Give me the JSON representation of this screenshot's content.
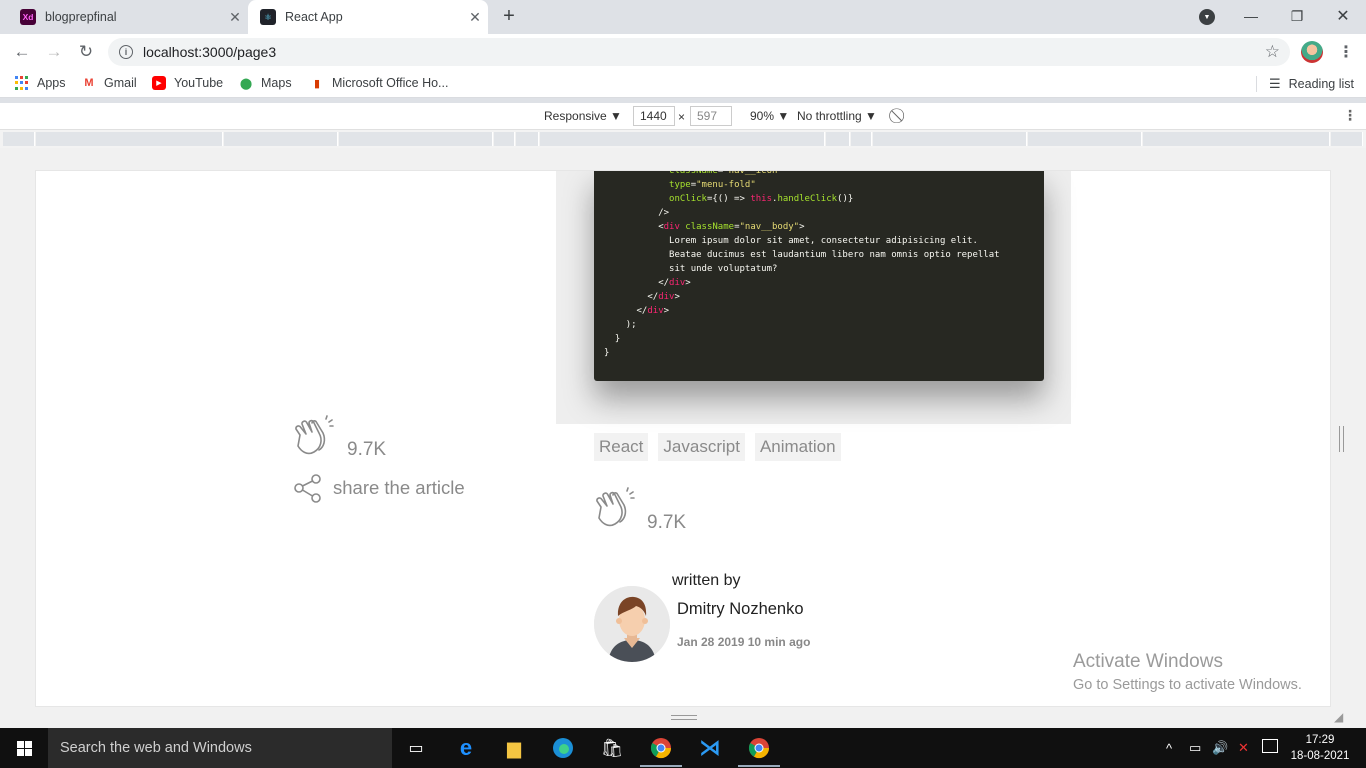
{
  "browser": {
    "tabs": [
      {
        "title": "blogprepfinal",
        "favicon": "adobe-xd-icon",
        "active": false
      },
      {
        "title": "React App",
        "favicon": "react-icon",
        "active": true
      }
    ],
    "new_tab_symbol": "+",
    "url": "localhost:3000/page3",
    "bookmarks": [
      {
        "label": "Apps",
        "icon": "apps-grid-icon"
      },
      {
        "label": "Gmail",
        "icon": "gmail-icon"
      },
      {
        "label": "YouTube",
        "icon": "youtube-icon"
      },
      {
        "label": "Maps",
        "icon": "maps-icon"
      },
      {
        "label": "Microsoft Office Ho...",
        "icon": "office-icon"
      }
    ],
    "reading_list": "Reading list"
  },
  "devtools": {
    "device": "Responsive",
    "width": "1440",
    "height": "597",
    "zoom": "90%",
    "throttling": "No throttling",
    "times": "×"
  },
  "article": {
    "code_lines": [
      {
        "indent": "            ",
        "parts": [
          {
            "t": "className",
            "c": "c-attr"
          },
          {
            "t": "=",
            "c": ""
          },
          {
            "t": "\"nav__icon\"",
            "c": "c-str"
          }
        ]
      },
      {
        "indent": "            ",
        "parts": [
          {
            "t": "type",
            "c": "c-attr"
          },
          {
            "t": "=",
            "c": ""
          },
          {
            "t": "\"menu-fold\"",
            "c": "c-str"
          }
        ]
      },
      {
        "indent": "            ",
        "parts": [
          {
            "t": "onClick",
            "c": "c-attr"
          },
          {
            "t": "={() => ",
            "c": ""
          },
          {
            "t": "this",
            "c": "c-kw"
          },
          {
            "t": ".",
            "c": ""
          },
          {
            "t": "handleClick",
            "c": "c-fn"
          },
          {
            "t": "()}",
            "c": ""
          }
        ]
      },
      {
        "indent": "          ",
        "parts": [
          {
            "t": "/>",
            "c": ""
          }
        ]
      },
      {
        "indent": "          ",
        "parts": [
          {
            "t": "<",
            "c": ""
          },
          {
            "t": "div",
            "c": "c-tag"
          },
          {
            "t": " ",
            "c": ""
          },
          {
            "t": "className",
            "c": "c-attr"
          },
          {
            "t": "=",
            "c": ""
          },
          {
            "t": "\"nav__body\"",
            "c": "c-str"
          },
          {
            "t": ">",
            "c": ""
          }
        ]
      },
      {
        "indent": "            ",
        "parts": [
          {
            "t": "Lorem ipsum dolor sit amet, consectetur adipisicing elit.",
            "c": ""
          }
        ]
      },
      {
        "indent": "            ",
        "parts": [
          {
            "t": "Beatae ducimus est laudantium libero nam omnis optio repellat",
            "c": ""
          }
        ]
      },
      {
        "indent": "            ",
        "parts": [
          {
            "t": "sit unde voluptatum?",
            "c": ""
          }
        ]
      },
      {
        "indent": "          ",
        "parts": [
          {
            "t": "</",
            "c": ""
          },
          {
            "t": "div",
            "c": "c-tag"
          },
          {
            "t": ">",
            "c": ""
          }
        ]
      },
      {
        "indent": "        ",
        "parts": [
          {
            "t": "</",
            "c": ""
          },
          {
            "t": "div",
            "c": "c-tag"
          },
          {
            "t": ">",
            "c": ""
          }
        ]
      },
      {
        "indent": "      ",
        "parts": [
          {
            "t": "</",
            "c": ""
          },
          {
            "t": "div",
            "c": "c-tag"
          },
          {
            "t": ">",
            "c": ""
          }
        ]
      },
      {
        "indent": "    ",
        "parts": [
          {
            "t": ");",
            "c": ""
          }
        ]
      },
      {
        "indent": "  ",
        "parts": [
          {
            "t": "}",
            "c": ""
          }
        ]
      },
      {
        "indent": "",
        "parts": [
          {
            "t": "}",
            "c": ""
          }
        ]
      }
    ],
    "side_clap_count": "9.7K",
    "share_label": "share the article",
    "tags": [
      "React",
      "Javascript",
      "Animation"
    ],
    "clap_count": "9.7K",
    "written_by": "written by",
    "author_name": "Dmitry Nozhenko",
    "post_meta": "Jan 28 2019 10 min ago"
  },
  "watermark": {
    "line1": "Activate Windows",
    "line2": "Go to Settings to activate Windows."
  },
  "taskbar": {
    "search_placeholder": "Search the web and Windows",
    "time": "17:29",
    "date": "18-08-2021"
  },
  "colors": {
    "code_bg": "#272822",
    "chip_bg": "#f2f2f2",
    "muted_text": "#8a8a8a"
  }
}
